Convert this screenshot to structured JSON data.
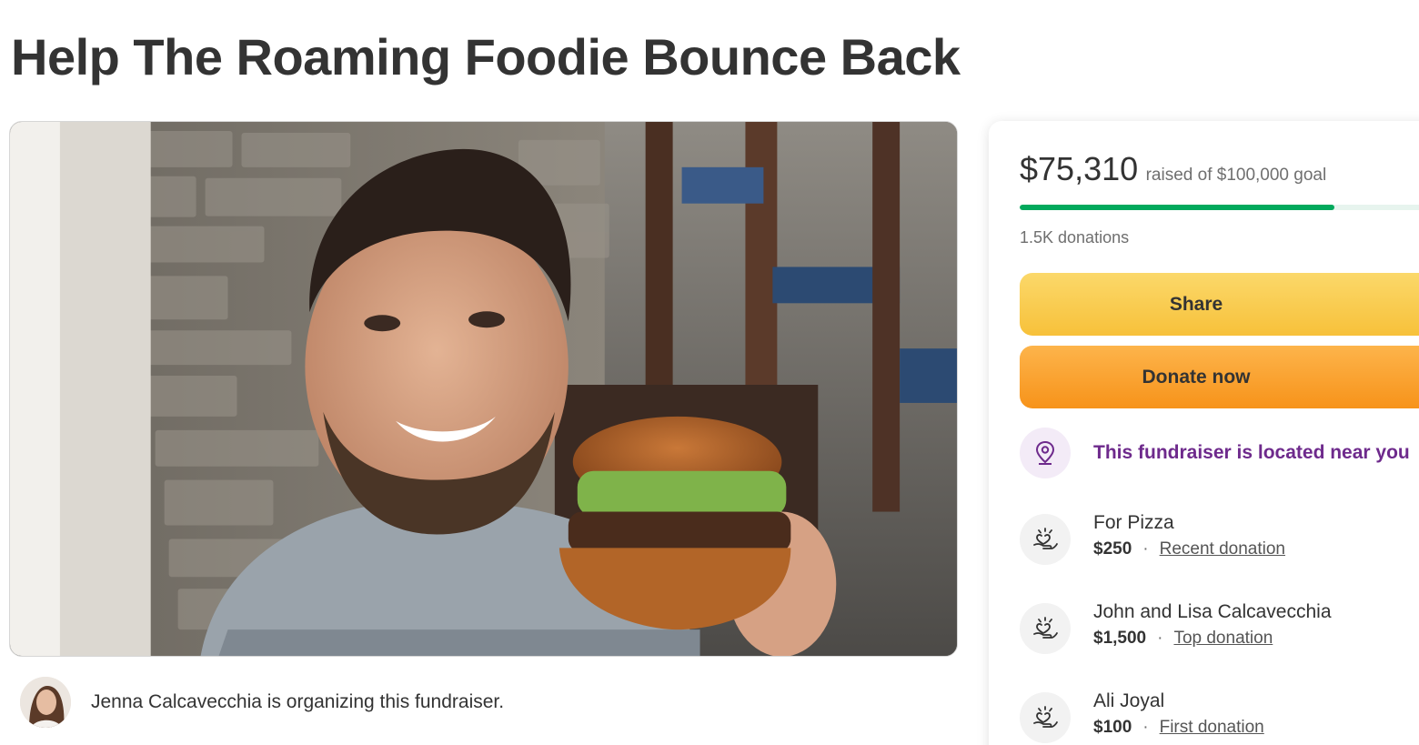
{
  "campaign": {
    "title": "Help The Roaming Foodie Bounce Back",
    "organizer_text": "Jenna Calcavecchia is organizing this fundraiser."
  },
  "funding": {
    "raised": "$75,310",
    "goal_text": "raised of $100,000 goal",
    "progress_fraction": 0.7531,
    "donations_count": "1.5K donations"
  },
  "actions": {
    "share_label": "Share",
    "donate_label": "Donate now"
  },
  "location": {
    "text": "This fundraiser is located near you"
  },
  "donations": [
    {
      "name": "For Pizza",
      "amount": "$250",
      "tag": "Recent donation"
    },
    {
      "name": "John and Lisa Calcavecchia",
      "amount": "$1,500",
      "tag": "Top donation"
    },
    {
      "name": "Ali Joyal",
      "amount": "$100",
      "tag": "First donation"
    }
  ],
  "colors": {
    "progress": "#02a95c",
    "share_button": "#f7c13a",
    "donate_button": "#f7931a",
    "location_text": "#6e2a8c"
  },
  "icons": {
    "location": "map-pin-icon",
    "donation": "heart-hand-icon"
  }
}
